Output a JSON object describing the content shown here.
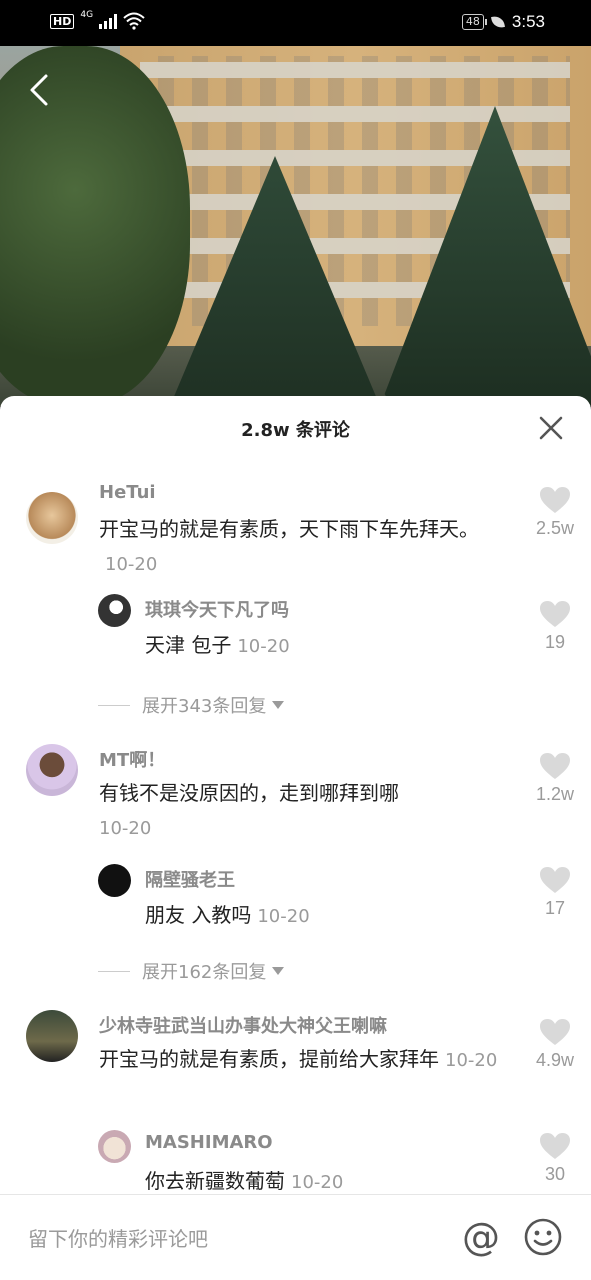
{
  "status_bar": {
    "network_hd": "HD",
    "network_gen": "4G",
    "battery": "48",
    "time": "3:53"
  },
  "sheet": {
    "title": "2.8w 条评论"
  },
  "comments": [
    {
      "user": "HeTui",
      "text": "开宝马的就是有素质，天下雨下车先拜天。",
      "date": "10-20",
      "likes": "2.5w",
      "reply": {
        "user": "琪琪今天下凡了吗",
        "text": "天津 包子",
        "date": "10-20",
        "likes": "19"
      },
      "expand": "展开343条回复"
    },
    {
      "user": "MT啊！",
      "text": "有钱不是没原因的，走到哪拜到哪",
      "date": "10-20",
      "likes": "1.2w",
      "reply": {
        "user": "隔壁骚老王",
        "text": "朋友 入教吗",
        "date": "10-20",
        "likes": "17"
      },
      "expand": "展开162条回复"
    },
    {
      "user": "少林寺驻武当山办事处大神父王喇嘛",
      "text": "开宝马的就是有素质，提前给大家拜年",
      "date": "10-20",
      "likes": "4.9w",
      "reply": {
        "user": "MASHIMARO",
        "text": "你去新疆数葡萄",
        "date": "10-20",
        "likes": "30"
      }
    }
  ],
  "input": {
    "placeholder": "留下你的精彩评论吧"
  },
  "icons": {
    "back": "chevron-left-icon",
    "close": "close-icon",
    "like": "heart-icon",
    "mention": "at-icon",
    "emoji": "smiley-icon"
  },
  "colors": {
    "like_gray": "#d9d9d9",
    "secondary_text": "#9a9a9a",
    "username_gray": "#8a8a8a"
  }
}
